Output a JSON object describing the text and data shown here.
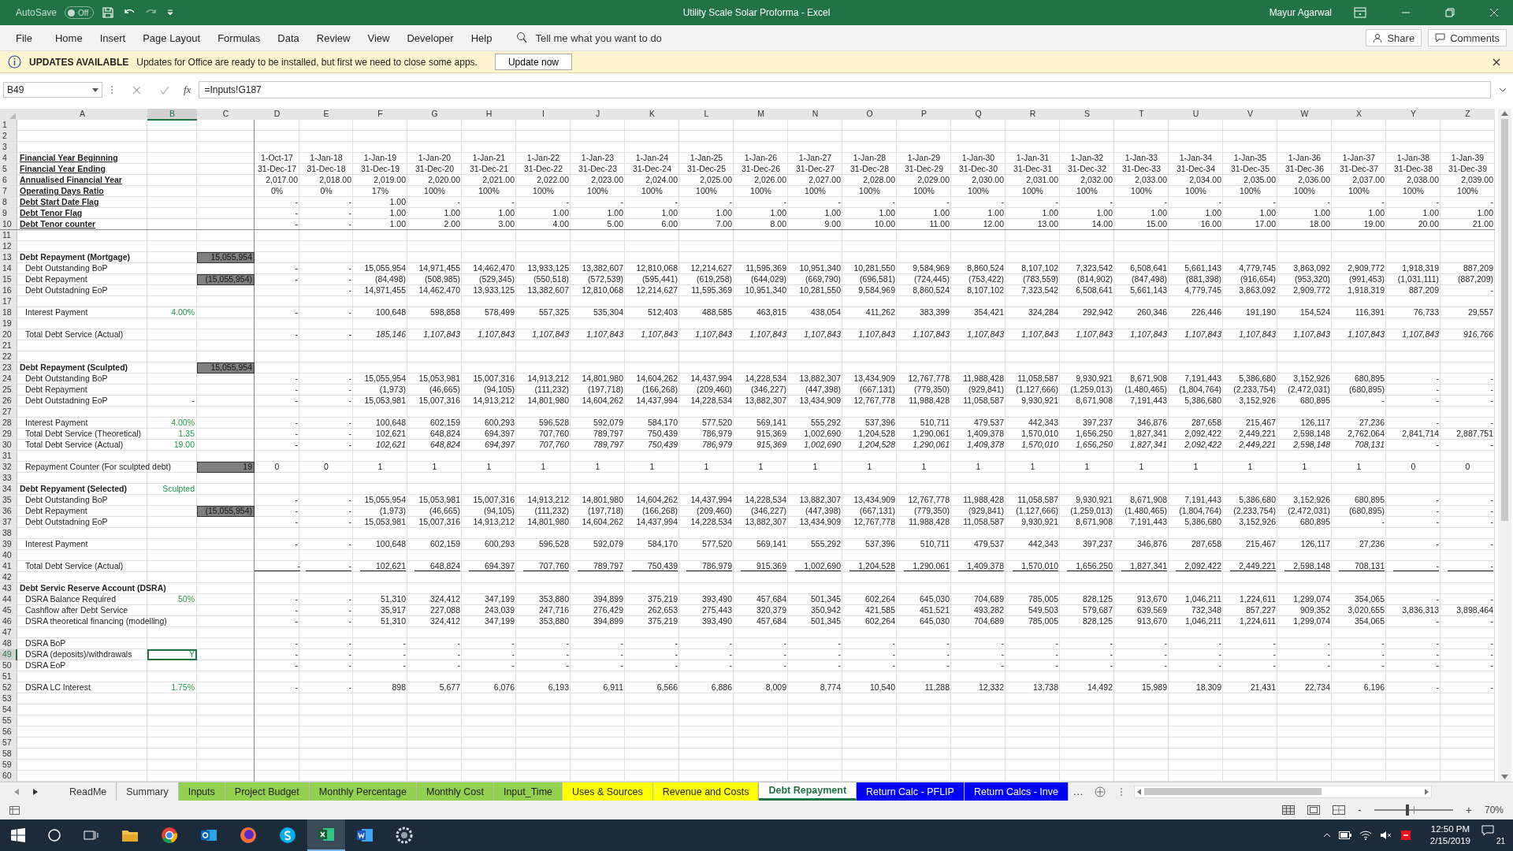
{
  "title_bar": {
    "autosave_label": "AutoSave",
    "autosave": {
      "on": false,
      "label": "Off"
    },
    "title": "Utility Scale Solar Proforma  -  Excel",
    "user": "Mayur Agarwal"
  },
  "menu": [
    "File",
    "Home",
    "Insert",
    "Page Layout",
    "Formulas",
    "Data",
    "Review",
    "View",
    "Developer",
    "Help"
  ],
  "tell_me": "Tell me what you want to do",
  "share": "Share",
  "comments": "Comments",
  "notice": {
    "title": "UPDATES AVAILABLE",
    "message": "Updates for Office are ready to be installed, but first we need to close some apps.",
    "button": "Update now"
  },
  "formula_bar": {
    "name_box": "B49",
    "fx": "fx",
    "formula": "=Inputs!G187"
  },
  "sheet": {
    "columns": [
      "A",
      "B",
      "C",
      "D",
      "E",
      "F",
      "G",
      "H",
      "I",
      "J",
      "K",
      "L",
      "M",
      "N",
      "O",
      "P",
      "Q",
      "R",
      "S",
      "T",
      "U",
      "V",
      "W",
      "X",
      "Y",
      "Z"
    ],
    "rows": [
      {
        "n": "1"
      },
      {
        "n": "2"
      },
      {
        "n": "3"
      },
      {
        "n": "4",
        "kind": "heading",
        "a": "Financial Year Beginning",
        "centered": true,
        "cells": [
          "1-Oct-17",
          "1-Jan-18",
          "1-Jan-19",
          "1-Jan-20",
          "1-Jan-21",
          "1-Jan-22",
          "1-Jan-23",
          "1-Jan-24",
          "1-Jan-25",
          "1-Jan-26",
          "1-Jan-27",
          "1-Jan-28",
          "1-Jan-29",
          "1-Jan-30",
          "1-Jan-31",
          "1-Jan-32",
          "1-Jan-33",
          "1-Jan-34",
          "1-Jan-35",
          "1-Jan-36",
          "1-Jan-37",
          "1-Jan-38",
          "1-Jan-39"
        ]
      },
      {
        "n": "5",
        "kind": "heading",
        "a": "Financial Year Ending",
        "centered": true,
        "cells": [
          "31-Dec-17",
          "31-Dec-18",
          "31-Dec-19",
          "31-Dec-20",
          "31-Dec-21",
          "31-Dec-22",
          "31-Dec-23",
          "31-Dec-24",
          "31-Dec-25",
          "31-Dec-26",
          "31-Dec-27",
          "31-Dec-28",
          "31-Dec-29",
          "31-Dec-30",
          "31-Dec-31",
          "31-Dec-32",
          "31-Dec-33",
          "31-Dec-34",
          "31-Dec-35",
          "31-Dec-36",
          "31-Dec-37",
          "31-Dec-38",
          "31-Dec-39"
        ]
      },
      {
        "n": "6",
        "kind": "heading",
        "a": "Annualised Financial Year",
        "cells": [
          "2,017.00",
          "2,018.00",
          "2,019.00",
          "2,020.00",
          "2,021.00",
          "2,022.00",
          "2,023.00",
          "2,024.00",
          "2,025.00",
          "2,026.00",
          "2,027.00",
          "2,028.00",
          "2,029.00",
          "2,030.00",
          "2,031.00",
          "2,032.00",
          "2,033.00",
          "2,034.00",
          "2,035.00",
          "2,036.00",
          "2,037.00",
          "2,038.00",
          "2,039.00"
        ]
      },
      {
        "n": "7",
        "kind": "heading",
        "a": "Operating Days Ratio",
        "centered": true,
        "cells": [
          "0%",
          "0%",
          "17%",
          "100%",
          "100%",
          "100%",
          "100%",
          "100%",
          "100%",
          "100%",
          "100%",
          "100%",
          "100%",
          "100%",
          "100%",
          "100%",
          "100%",
          "100%",
          "100%",
          "100%",
          "100%",
          "100%",
          "100%"
        ]
      },
      {
        "n": "8",
        "kind": "heading",
        "a": "Debt Start Date Flag",
        "cells": [
          "-",
          "-",
          "1.00",
          "-",
          "-",
          "-",
          "-",
          "-",
          "-",
          "-",
          "-",
          "-",
          "-",
          "-",
          "-",
          "-",
          "-",
          "-",
          "-",
          "-",
          "-",
          "-",
          "-"
        ]
      },
      {
        "n": "9",
        "kind": "heading",
        "a": "Debt Tenor Flag",
        "cells": [
          "-",
          "-",
          "1.00",
          "1.00",
          "1.00",
          "1.00",
          "1.00",
          "1.00",
          "1.00",
          "1.00",
          "1.00",
          "1.00",
          "1.00",
          "1.00",
          "1.00",
          "1.00",
          "1.00",
          "1.00",
          "1.00",
          "1.00",
          "1.00",
          "1.00",
          "1.00"
        ]
      },
      {
        "n": "10",
        "kind": "heading",
        "a": "Debt Tenor counter",
        "cells": [
          "-",
          "-",
          "1.00",
          "2.00",
          "3.00",
          "4.00",
          "5.00",
          "6.00",
          "7.00",
          "8.00",
          "9.00",
          "10.00",
          "11.00",
          "12.00",
          "13.00",
          "14.00",
          "15.00",
          "16.00",
          "17.00",
          "18.00",
          "19.00",
          "20.00",
          "21.00"
        ]
      },
      {
        "n": "11"
      },
      {
        "n": "12"
      },
      {
        "n": "13",
        "kind": "section",
        "a": "Debt Repayment (Mortgage)",
        "c": "15,055,954",
        "c_highlight": true
      },
      {
        "n": "14",
        "kind": "item",
        "a": "Debt Outstanding BoP",
        "cells": [
          "-",
          "-",
          "15,055,954",
          "14,971,455",
          "14,462,470",
          "13,933,125",
          "13,382,607",
          "12,810,068",
          "12,214,627",
          "11,595,369",
          "10,951,340",
          "10,281,550",
          "9,584,969",
          "8,860,524",
          "8,107,102",
          "7,323,542",
          "6,508,641",
          "5,661,143",
          "4,779,745",
          "3,863,092",
          "2,909,772",
          "1,918,319",
          "887,209"
        ]
      },
      {
        "n": "15",
        "kind": "item",
        "a": "Debt Repayment",
        "c": "(15,055,954)",
        "c_highlight": true,
        "cells": [
          "-",
          "-",
          "(84,498)",
          "(508,985)",
          "(529,345)",
          "(550,518)",
          "(572,539)",
          "(595,441)",
          "(619,258)",
          "(644,029)",
          "(669,790)",
          "(696,581)",
          "(724,445)",
          "(753,422)",
          "(783,559)",
          "(814,902)",
          "(847,498)",
          "(881,398)",
          "(916,654)",
          "(953,320)",
          "(991,453)",
          "(1,031,111)",
          "(887,209)"
        ]
      },
      {
        "n": "16",
        "kind": "item",
        "a": "Debt Outstadning EoP",
        "cells": [
          null,
          "-",
          "14,971,455",
          "14,462,470",
          "13,933,125",
          "13,382,607",
          "12,810,068",
          "12,214,627",
          "11,595,369",
          "10,951,340",
          "10,281,550",
          "9,584,969",
          "8,860,524",
          "8,107,102",
          "7,323,542",
          "6,508,641",
          "5,661,143",
          "4,779,745",
          "3,863,092",
          "2,909,772",
          "1,918,319",
          "887,209",
          "-"
        ]
      },
      {
        "n": "17"
      },
      {
        "n": "18",
        "kind": "item",
        "a": "Interest Payment",
        "b": "4.00%",
        "b_input": true,
        "cells": [
          "-",
          "-",
          "100,648",
          "598,858",
          "578,499",
          "557,325",
          "535,304",
          "512,403",
          "488,585",
          "463,815",
          "438,054",
          "411,262",
          "383,399",
          "354,421",
          "324,284",
          "292,942",
          "260,346",
          "226,446",
          "191,190",
          "154,524",
          "116,391",
          "76,733",
          "29,557"
        ]
      },
      {
        "n": "19"
      },
      {
        "n": "20",
        "kind": "item",
        "a": "Total Debt Service (Actual)",
        "values_italic": true,
        "cells": [
          "-",
          "-",
          "185,146",
          "1,107,843",
          "1,107,843",
          "1,107,843",
          "1,107,843",
          "1,107,843",
          "1,107,843",
          "1,107,843",
          "1,107,843",
          "1,107,843",
          "1,107,843",
          "1,107,843",
          "1,107,843",
          "1,107,843",
          "1,107,843",
          "1,107,843",
          "1,107,843",
          "1,107,843",
          "1,107,843",
          "1,107,843",
          "916,766"
        ]
      },
      {
        "n": "21"
      },
      {
        "n": "22"
      },
      {
        "n": "23",
        "kind": "section",
        "a": "Debt Repayment (Sculpted)",
        "c": "15,055,954",
        "c_highlight": true
      },
      {
        "n": "24",
        "kind": "item",
        "a": "Debt Outstanding BoP",
        "cells": [
          "-",
          "-",
          "15,055,954",
          "15,053,981",
          "15,007,316",
          "14,913,212",
          "14,801,980",
          "14,604,262",
          "14,437,994",
          "14,228,534",
          "13,882,307",
          "13,434,909",
          "12,767,778",
          "11,988,428",
          "11,058,587",
          "9,930,921",
          "8,671,908",
          "7,191,443",
          "5,386,680",
          "3,152,926",
          "680,895",
          "-",
          "-"
        ]
      },
      {
        "n": "25",
        "kind": "item",
        "a": "Debt Repayment",
        "cells": [
          "-",
          "-",
          "(1,973)",
          "(46,665)",
          "(94,105)",
          "(111,232)",
          "(197,718)",
          "(166,268)",
          "(209,460)",
          "(346,227)",
          "(447,398)",
          "(667,131)",
          "(779,350)",
          "(929,841)",
          "(1,127,666)",
          "(1,259,013)",
          "(1,480,465)",
          "(1,804,764)",
          "(2,233,754)",
          "(2,472,031)",
          "(680,895)",
          "-",
          "-"
        ]
      },
      {
        "n": "26",
        "kind": "item",
        "a": "Debt Outstadning EoP",
        "b": "-",
        "cells": [
          "-",
          "-",
          "15,053,981",
          "15,007,316",
          "14,913,212",
          "14,801,980",
          "14,604,262",
          "14,437,994",
          "14,228,534",
          "13,882,307",
          "13,434,909",
          "12,767,778",
          "11,988,428",
          "11,058,587",
          "9,930,921",
          "8,671,908",
          "7,191,443",
          "5,386,680",
          "3,152,926",
          "680,895",
          "-",
          "-",
          "-"
        ]
      },
      {
        "n": "27"
      },
      {
        "n": "28",
        "kind": "item",
        "a": "Interest Payment",
        "b": "4.00%",
        "b_input": true,
        "cells": [
          "-",
          "-",
          "100,648",
          "602,159",
          "600,293",
          "596,528",
          "592,079",
          "584,170",
          "577,520",
          "569,141",
          "555,292",
          "537,396",
          "510,711",
          "479,537",
          "442,343",
          "397,237",
          "346,876",
          "287,658",
          "215,467",
          "126,117",
          "27,236",
          "-",
          "-"
        ]
      },
      {
        "n": "29",
        "kind": "item",
        "a": "Total Debt Service (Theoretical)",
        "b": "1.35",
        "b_input": true,
        "cells": [
          "-",
          "-",
          "102,621",
          "648,824",
          "694,397",
          "707,760",
          "789,797",
          "750,439",
          "786,979",
          "915,369",
          "1,002,690",
          "1,204,528",
          "1,290,061",
          "1,409,378",
          "1,570,010",
          "1,656,250",
          "1,827,341",
          "2,092,422",
          "2,449,221",
          "2,598,148",
          "2,762,064",
          "2,841,714",
          "2,887,751"
        ]
      },
      {
        "n": "30",
        "kind": "item",
        "a": "Total Debt Service (Actual)",
        "b": "19.00",
        "b_input": true,
        "values_italic": true,
        "cells": [
          "-",
          "-",
          "102,621",
          "648,824",
          "694,397",
          "707,760",
          "789,797",
          "750,439",
          "786,979",
          "915,369",
          "1,002,690",
          "1,204,528",
          "1,290,061",
          "1,409,378",
          "1,570,010",
          "1,656,250",
          "1,827,341",
          "2,092,422",
          "2,449,221",
          "2,598,148",
          "708,131",
          "-",
          "-"
        ]
      },
      {
        "n": "31"
      },
      {
        "n": "32",
        "kind": "item",
        "a": "Repayment Counter (For sculpted debt)",
        "c": "19",
        "c_highlight": true,
        "centered": true,
        "cells": [
          "0",
          "0",
          "1",
          "1",
          "1",
          "1",
          "1",
          "1",
          "1",
          "1",
          "1",
          "1",
          "1",
          "1",
          "1",
          "1",
          "1",
          "1",
          "1",
          "1",
          "1",
          "0",
          "0"
        ]
      },
      {
        "n": "33"
      },
      {
        "n": "34",
        "kind": "section",
        "a": "Debt Repyament (Selected)",
        "b": "Sculpted",
        "b_input": true
      },
      {
        "n": "35",
        "kind": "item",
        "a": "Debt Outstanding BoP",
        "cells": [
          "-",
          "-",
          "15,055,954",
          "15,053,981",
          "15,007,316",
          "14,913,212",
          "14,801,980",
          "14,604,262",
          "14,437,994",
          "14,228,534",
          "13,882,307",
          "13,434,909",
          "12,767,778",
          "11,988,428",
          "11,058,587",
          "9,930,921",
          "8,671,908",
          "7,191,443",
          "5,386,680",
          "3,152,926",
          "680,895",
          "-",
          "-"
        ]
      },
      {
        "n": "36",
        "kind": "item",
        "a": "Debt Repayment",
        "c": "(15,055,954)",
        "c_highlight": true,
        "cells": [
          "-",
          "-",
          "(1,973)",
          "(46,665)",
          "(94,105)",
          "(111,232)",
          "(197,718)",
          "(166,268)",
          "(209,460)",
          "(346,227)",
          "(447,398)",
          "(667,131)",
          "(779,350)",
          "(929,841)",
          "(1,127,666)",
          "(1,259,013)",
          "(1,480,465)",
          "(1,804,764)",
          "(2,233,754)",
          "(2,472,031)",
          "(680,895)",
          "-",
          "-"
        ]
      },
      {
        "n": "37",
        "kind": "item",
        "a": "Debt Outstadning EoP",
        "cells": [
          "-",
          "-",
          "15,053,981",
          "15,007,316",
          "14,913,212",
          "14,801,980",
          "14,604,262",
          "14,437,994",
          "14,228,534",
          "13,882,307",
          "13,434,909",
          "12,767,778",
          "11,988,428",
          "11,058,587",
          "9,930,921",
          "8,671,908",
          "7,191,443",
          "5,386,680",
          "3,152,926",
          "680,895",
          "-",
          "-",
          "-"
        ]
      },
      {
        "n": "38"
      },
      {
        "n": "39",
        "kind": "item",
        "a": "Interest Payment",
        "cells": [
          "-",
          "-",
          "100,648",
          "602,159",
          "600,293",
          "596,528",
          "592,079",
          "584,170",
          "577,520",
          "569,141",
          "555,292",
          "537,396",
          "510,711",
          "479,537",
          "442,343",
          "397,237",
          "346,876",
          "287,658",
          "215,467",
          "126,117",
          "27,236",
          "-",
          "-"
        ]
      },
      {
        "n": "40"
      },
      {
        "n": "41",
        "kind": "item",
        "a": "Total Debt Service (Actual)",
        "values_total": true,
        "cells": [
          "-",
          "-",
          "102,621",
          "648,824",
          "694,397",
          "707,760",
          "789,797",
          "750,439",
          "786,979",
          "915,369",
          "1,002,690",
          "1,204,528",
          "1,290,061",
          "1,409,378",
          "1,570,010",
          "1,656,250",
          "1,827,341",
          "2,092,422",
          "2,449,221",
          "2,598,148",
          "708,131",
          "-",
          "-"
        ]
      },
      {
        "n": "42"
      },
      {
        "n": "43",
        "kind": "section",
        "a": "Debt Servic Reserve Account (DSRA)"
      },
      {
        "n": "44",
        "kind": "item",
        "a": "DSRA Balance Required",
        "b": "50%",
        "b_input": true,
        "cells": [
          "-",
          "-",
          "51,310",
          "324,412",
          "347,199",
          "353,880",
          "394,899",
          "375,219",
          "393,490",
          "457,684",
          "501,345",
          "602,264",
          "645,030",
          "704,689",
          "785,005",
          "828,125",
          "913,670",
          "1,046,211",
          "1,224,611",
          "1,299,074",
          "354,065",
          "-",
          "-"
        ]
      },
      {
        "n": "45",
        "kind": "item",
        "a": "Cashflow after Debt Service",
        "cells": [
          "-",
          "-",
          "35,917",
          "227,088",
          "243,039",
          "247,716",
          "276,429",
          "262,653",
          "275,443",
          "320,379",
          "350,942",
          "421,585",
          "451,521",
          "493,282",
          "549,503",
          "579,687",
          "639,569",
          "732,348",
          "857,227",
          "909,352",
          "3,020,655",
          "3,836,313",
          "3,898,464"
        ]
      },
      {
        "n": "46",
        "kind": "item",
        "a": "DSRA theoretical financing (modelling)",
        "cells": [
          "-",
          "-",
          "51,310",
          "324,412",
          "347,199",
          "353,880",
          "394,899",
          "375,219",
          "393,490",
          "457,684",
          "501,345",
          "602,264",
          "645,030",
          "704,689",
          "785,005",
          "828,125",
          "913,670",
          "1,046,211",
          "1,224,611",
          "1,299,074",
          "354,065",
          "-",
          "-"
        ]
      },
      {
        "n": "47"
      },
      {
        "n": "48",
        "kind": "item",
        "a": "DSRA BoP",
        "cells": [
          "-",
          "-",
          "-",
          "-",
          "-",
          "-",
          "-",
          "-",
          "-",
          "-",
          "-",
          "-",
          "-",
          "-",
          "-",
          "-",
          "-",
          "-",
          "-",
          "-",
          "-",
          "-",
          "-"
        ]
      },
      {
        "n": "49",
        "kind": "item",
        "a": "DSRA (deposits)/withdrawals",
        "b": "Y",
        "b_input": true,
        "b_selected": true,
        "cells": [
          "-",
          "-",
          "-",
          "-",
          "-",
          "-",
          "-",
          "-",
          "-",
          "-",
          "-",
          "-",
          "-",
          "-",
          "-",
          "-",
          "-",
          "-",
          "-",
          "-",
          "-",
          "-",
          "-"
        ]
      },
      {
        "n": "50",
        "kind": "item",
        "a": "DSRA EoP",
        "cells": [
          "-",
          "-",
          "-",
          "-",
          "-",
          "-",
          "-",
          "-",
          "-",
          "-",
          "-",
          "-",
          "-",
          "-",
          "-",
          "-",
          "-",
          "-",
          "-",
          "-",
          "-",
          "-",
          "-"
        ]
      },
      {
        "n": "51"
      },
      {
        "n": "52",
        "kind": "item",
        "a": "DSRA LC Interest",
        "b": "1.75%",
        "b_input": true,
        "cells": [
          "-",
          "-",
          "898",
          "5,677",
          "6,076",
          "6,193",
          "6,911",
          "6,566",
          "6,886",
          "8,009",
          "8,774",
          "10,540",
          "11,288",
          "12,332",
          "13,738",
          "14,492",
          "15,989",
          "18,309",
          "21,431",
          "22,734",
          "6,196",
          "-",
          "-"
        ]
      },
      {
        "n": "53"
      },
      {
        "n": "54"
      },
      {
        "n": "55"
      },
      {
        "n": "56"
      },
      {
        "n": "57"
      },
      {
        "n": "58"
      },
      {
        "n": "59"
      },
      {
        "n": "60"
      }
    ]
  },
  "sheet_tabs": [
    {
      "label": "ReadMe",
      "selected": false
    },
    {
      "label": "Summary",
      "selected": false
    },
    {
      "label": "Inputs",
      "selected": false,
      "color": "#92d050"
    },
    {
      "label": "Project Budget",
      "selected": false,
      "color": "#92d050"
    },
    {
      "label": "Monthly Percentage",
      "selected": false,
      "color": "#92d050"
    },
    {
      "label": "Monthly Cost",
      "selected": false,
      "color": "#92d050"
    },
    {
      "label": "Input_Time",
      "selected": false,
      "color": "#92d050"
    },
    {
      "label": "Uses & Sources",
      "selected": false,
      "color": "#ffff00"
    },
    {
      "label": "Revenue and Costs",
      "selected": false,
      "color": "#ffff00"
    },
    {
      "label": "Debt Repayment",
      "selected": true
    },
    {
      "label": "Return Calc - PFLIP",
      "selected": false,
      "color": "#0000ff"
    },
    {
      "label": "Return Calcs - Inve",
      "selected": false,
      "color": "#0000ff"
    }
  ],
  "more_tabs": "...",
  "status_bar": {
    "zoom": "70%",
    "zoom_out": "-",
    "zoom_in": "+",
    "zoom_slider": {
      "level": 0.42
    }
  },
  "taskbar": {
    "time": "12:50 PM",
    "date": "2/15/2019",
    "notifications": "21"
  }
}
